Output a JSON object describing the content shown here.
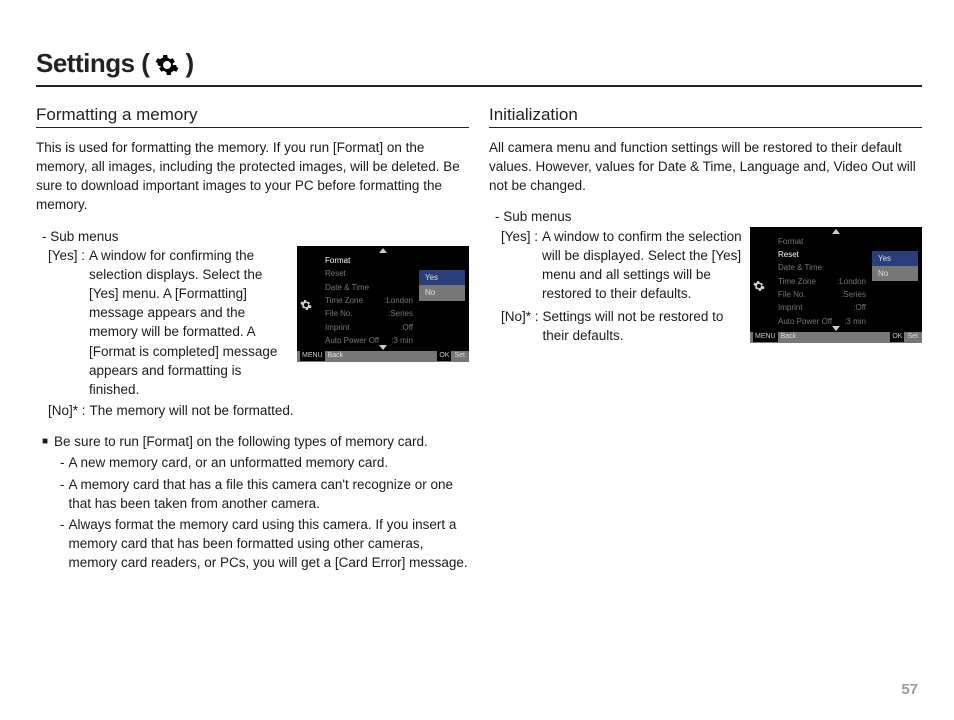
{
  "pageNumber": "57",
  "title_a": "Settings (",
  "title_b": ")",
  "left": {
    "heading": "Formatting a memory",
    "intro": "This is used for formatting the memory. If you run [Format] on the memory, all images, including the protected images, will be deleted. Be sure to download important images to your PC before formatting the memory.",
    "subLabel": "- Sub menus",
    "yesKey": "[Yes]  : ",
    "yesText": "A window for confirming the selection displays. Select the [Yes] menu. A [Formatting] message appears and the memory will be formatted. A [Format is completed] message appears and formatting is finished.",
    "noKey": "[No]* : ",
    "noText": "The memory will not be formatted.",
    "noteHead": "Be sure to run [Format] on the following types of memory card.",
    "note1": "A new memory card, or an unformatted memory card.",
    "note2": "A memory card that has a file this camera can't recognize or one that has been taken from another camera.",
    "note3": "Always format the memory card using this camera. If you insert a memory card that has been formatted using other cameras, memory card readers, or PCs, you will get a [Card Error] message."
  },
  "right": {
    "heading": "Initialization",
    "intro": "All camera menu and function settings will be restored to their default values. However, values for Date & Time, Language and, Video Out will not be changed.",
    "subLabel": "- Sub menus",
    "yesKey": "[Yes]  : ",
    "yesText": "A window to confirm the selection will be displayed. Select the [Yes] menu and all settings will be restored to their defaults.",
    "noKey": "[No]*  : ",
    "noText": "Settings will not be restored to their defaults."
  },
  "shot": {
    "menu": [
      {
        "l": "Format",
        "r": ""
      },
      {
        "l": "Reset",
        "r": ""
      },
      {
        "l": "Date & Time",
        "r": ""
      },
      {
        "l": "Time Zone",
        "r": ":London"
      },
      {
        "l": "File No.",
        "r": ":Series"
      },
      {
        "l": "Imprint",
        "r": ":Off"
      },
      {
        "l": "Auto Power Off",
        "r": ":3 min"
      }
    ],
    "optYes": "Yes",
    "optNo": "No",
    "barBack": "Back",
    "barMenu": "MENU",
    "barOk": "OK",
    "barSet": "Set"
  }
}
